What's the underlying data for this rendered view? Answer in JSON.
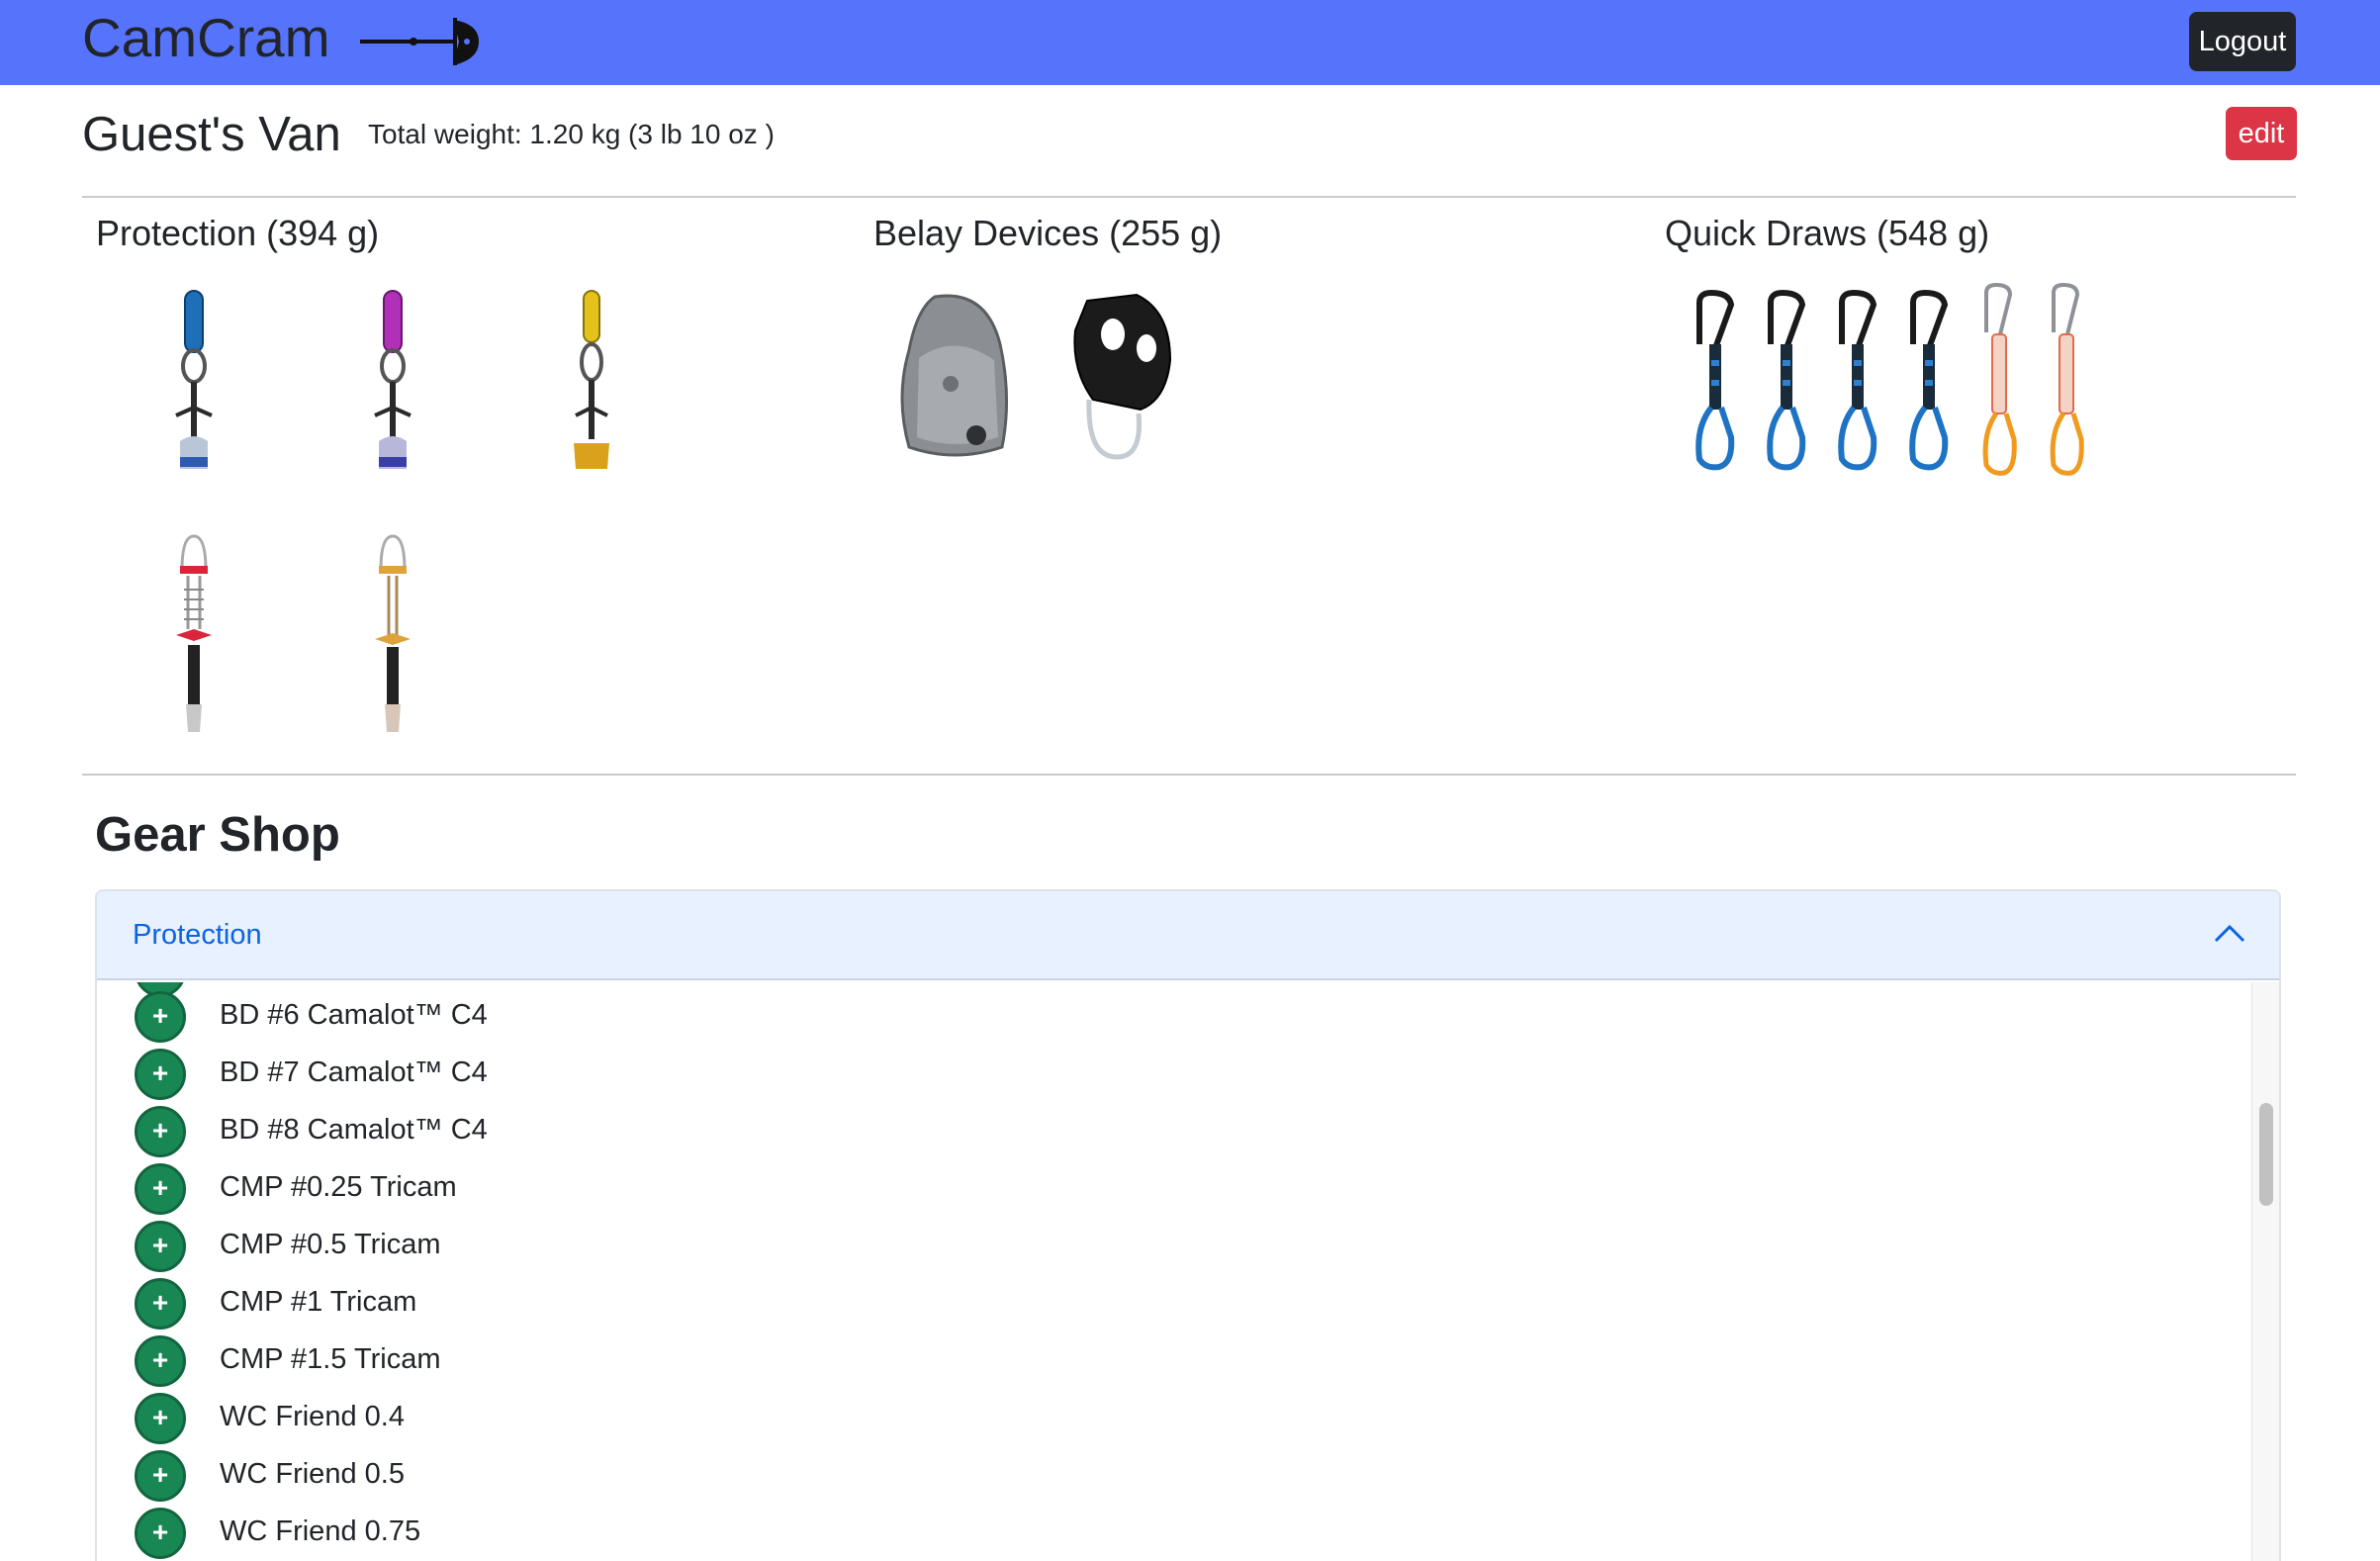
{
  "navbar": {
    "brand": "CamCram",
    "logout_label": "Logout"
  },
  "van": {
    "title": "Guest's Van",
    "total_weight": "Total weight: 1.20 kg (3 lb 10 oz )",
    "edit_label": "edit"
  },
  "sections": {
    "protection": {
      "title": "Protection (394 g)"
    },
    "belay": {
      "title": "Belay Devices (255 g)"
    },
    "quickdraws": {
      "title": "Quick Draws (548 g)"
    }
  },
  "colors": {
    "navbar": "#5673fb",
    "logout_bg": "#212529",
    "edit_bg": "#dc3545",
    "add_button": "#198754",
    "accordion_header": "#e7f1ff",
    "accordion_label": "#0c63e4"
  },
  "shop": {
    "title": "Gear Shop",
    "accordion_label": "Protection",
    "items": [
      {
        "name": "BD #6 Camalot™ C4",
        "icon": "plus-icon"
      },
      {
        "name": "BD #7 Camalot™ C4",
        "icon": "plus-icon"
      },
      {
        "name": "BD #8 Camalot™ C4",
        "icon": "plus-icon"
      },
      {
        "name": "CMP #0.25 Tricam",
        "icon": "plus-icon"
      },
      {
        "name": "CMP #0.5 Tricam",
        "icon": "plus-icon"
      },
      {
        "name": "CMP #1 Tricam",
        "icon": "plus-icon"
      },
      {
        "name": "CMP #1.5 Tricam",
        "icon": "plus-icon"
      },
      {
        "name": "WC Friend 0.4",
        "icon": "plus-icon"
      },
      {
        "name": "WC Friend 0.5",
        "icon": "plus-icon"
      },
      {
        "name": "WC Friend 0.75",
        "icon": "plus-icon"
      }
    ]
  }
}
